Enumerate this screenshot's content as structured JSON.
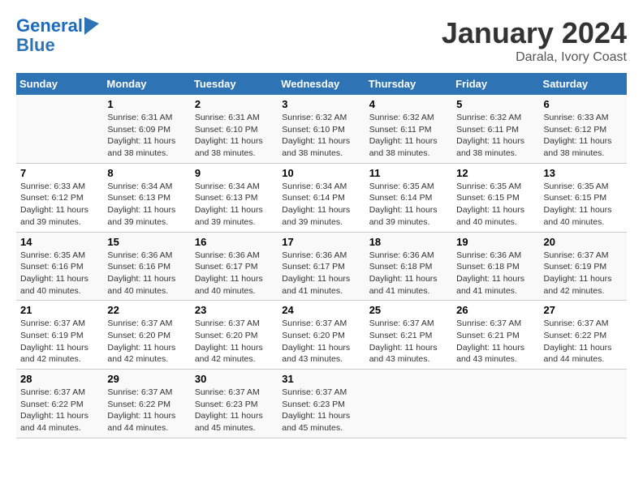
{
  "header": {
    "logo_line1": "General",
    "logo_line2": "Blue",
    "month": "January 2024",
    "location": "Darala, Ivory Coast"
  },
  "weekdays": [
    "Sunday",
    "Monday",
    "Tuesday",
    "Wednesday",
    "Thursday",
    "Friday",
    "Saturday"
  ],
  "weeks": [
    [
      {
        "day": "",
        "info": ""
      },
      {
        "day": "1",
        "info": "Sunrise: 6:31 AM\nSunset: 6:09 PM\nDaylight: 11 hours\nand 38 minutes."
      },
      {
        "day": "2",
        "info": "Sunrise: 6:31 AM\nSunset: 6:10 PM\nDaylight: 11 hours\nand 38 minutes."
      },
      {
        "day": "3",
        "info": "Sunrise: 6:32 AM\nSunset: 6:10 PM\nDaylight: 11 hours\nand 38 minutes."
      },
      {
        "day": "4",
        "info": "Sunrise: 6:32 AM\nSunset: 6:11 PM\nDaylight: 11 hours\nand 38 minutes."
      },
      {
        "day": "5",
        "info": "Sunrise: 6:32 AM\nSunset: 6:11 PM\nDaylight: 11 hours\nand 38 minutes."
      },
      {
        "day": "6",
        "info": "Sunrise: 6:33 AM\nSunset: 6:12 PM\nDaylight: 11 hours\nand 38 minutes."
      }
    ],
    [
      {
        "day": "7",
        "info": "Sunrise: 6:33 AM\nSunset: 6:12 PM\nDaylight: 11 hours\nand 39 minutes."
      },
      {
        "day": "8",
        "info": "Sunrise: 6:34 AM\nSunset: 6:13 PM\nDaylight: 11 hours\nand 39 minutes."
      },
      {
        "day": "9",
        "info": "Sunrise: 6:34 AM\nSunset: 6:13 PM\nDaylight: 11 hours\nand 39 minutes."
      },
      {
        "day": "10",
        "info": "Sunrise: 6:34 AM\nSunset: 6:14 PM\nDaylight: 11 hours\nand 39 minutes."
      },
      {
        "day": "11",
        "info": "Sunrise: 6:35 AM\nSunset: 6:14 PM\nDaylight: 11 hours\nand 39 minutes."
      },
      {
        "day": "12",
        "info": "Sunrise: 6:35 AM\nSunset: 6:15 PM\nDaylight: 11 hours\nand 40 minutes."
      },
      {
        "day": "13",
        "info": "Sunrise: 6:35 AM\nSunset: 6:15 PM\nDaylight: 11 hours\nand 40 minutes."
      }
    ],
    [
      {
        "day": "14",
        "info": "Sunrise: 6:35 AM\nSunset: 6:16 PM\nDaylight: 11 hours\nand 40 minutes."
      },
      {
        "day": "15",
        "info": "Sunrise: 6:36 AM\nSunset: 6:16 PM\nDaylight: 11 hours\nand 40 minutes."
      },
      {
        "day": "16",
        "info": "Sunrise: 6:36 AM\nSunset: 6:17 PM\nDaylight: 11 hours\nand 40 minutes."
      },
      {
        "day": "17",
        "info": "Sunrise: 6:36 AM\nSunset: 6:17 PM\nDaylight: 11 hours\nand 41 minutes."
      },
      {
        "day": "18",
        "info": "Sunrise: 6:36 AM\nSunset: 6:18 PM\nDaylight: 11 hours\nand 41 minutes."
      },
      {
        "day": "19",
        "info": "Sunrise: 6:36 AM\nSunset: 6:18 PM\nDaylight: 11 hours\nand 41 minutes."
      },
      {
        "day": "20",
        "info": "Sunrise: 6:37 AM\nSunset: 6:19 PM\nDaylight: 11 hours\nand 42 minutes."
      }
    ],
    [
      {
        "day": "21",
        "info": "Sunrise: 6:37 AM\nSunset: 6:19 PM\nDaylight: 11 hours\nand 42 minutes."
      },
      {
        "day": "22",
        "info": "Sunrise: 6:37 AM\nSunset: 6:20 PM\nDaylight: 11 hours\nand 42 minutes."
      },
      {
        "day": "23",
        "info": "Sunrise: 6:37 AM\nSunset: 6:20 PM\nDaylight: 11 hours\nand 42 minutes."
      },
      {
        "day": "24",
        "info": "Sunrise: 6:37 AM\nSunset: 6:20 PM\nDaylight: 11 hours\nand 43 minutes."
      },
      {
        "day": "25",
        "info": "Sunrise: 6:37 AM\nSunset: 6:21 PM\nDaylight: 11 hours\nand 43 minutes."
      },
      {
        "day": "26",
        "info": "Sunrise: 6:37 AM\nSunset: 6:21 PM\nDaylight: 11 hours\nand 43 minutes."
      },
      {
        "day": "27",
        "info": "Sunrise: 6:37 AM\nSunset: 6:22 PM\nDaylight: 11 hours\nand 44 minutes."
      }
    ],
    [
      {
        "day": "28",
        "info": "Sunrise: 6:37 AM\nSunset: 6:22 PM\nDaylight: 11 hours\nand 44 minutes."
      },
      {
        "day": "29",
        "info": "Sunrise: 6:37 AM\nSunset: 6:22 PM\nDaylight: 11 hours\nand 44 minutes."
      },
      {
        "day": "30",
        "info": "Sunrise: 6:37 AM\nSunset: 6:23 PM\nDaylight: 11 hours\nand 45 minutes."
      },
      {
        "day": "31",
        "info": "Sunrise: 6:37 AM\nSunset: 6:23 PM\nDaylight: 11 hours\nand 45 minutes."
      },
      {
        "day": "",
        "info": ""
      },
      {
        "day": "",
        "info": ""
      },
      {
        "day": "",
        "info": ""
      }
    ]
  ]
}
